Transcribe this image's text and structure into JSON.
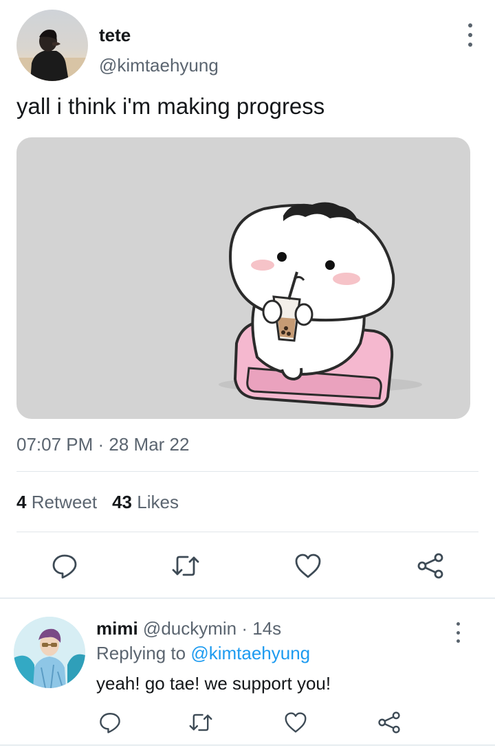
{
  "tweet": {
    "author": {
      "name": "tete",
      "handle": "@kimtaehyung"
    },
    "text": "yall i think i'm making progress",
    "media": {
      "description_icon": "sticker-drinking-boba-icon"
    },
    "time": "07:07 PM",
    "separator": " · ",
    "date": "28 Mar 22",
    "stats": {
      "retweets": "4",
      "retweets_label": "Retweet",
      "likes": "43",
      "likes_label": "Likes"
    },
    "actions": [
      "reply-icon",
      "retweet-icon",
      "like-icon",
      "share-icon"
    ]
  },
  "reply": {
    "name": "mimi",
    "handle": "@duckymin",
    "separator": " · ",
    "time": "14s",
    "replying_prefix": "Replying to",
    "replying_to": "@kimtaehyung",
    "text": "yeah! go tae! we support you!",
    "actions": [
      "reply-icon",
      "retweet-icon",
      "like-icon",
      "share-icon"
    ]
  },
  "colors": {
    "text_primary": "#14171a",
    "text_secondary": "#5b6570",
    "mention": "#1d9bf0",
    "divider": "#e1e6ea",
    "icon": "#3d4a55"
  }
}
